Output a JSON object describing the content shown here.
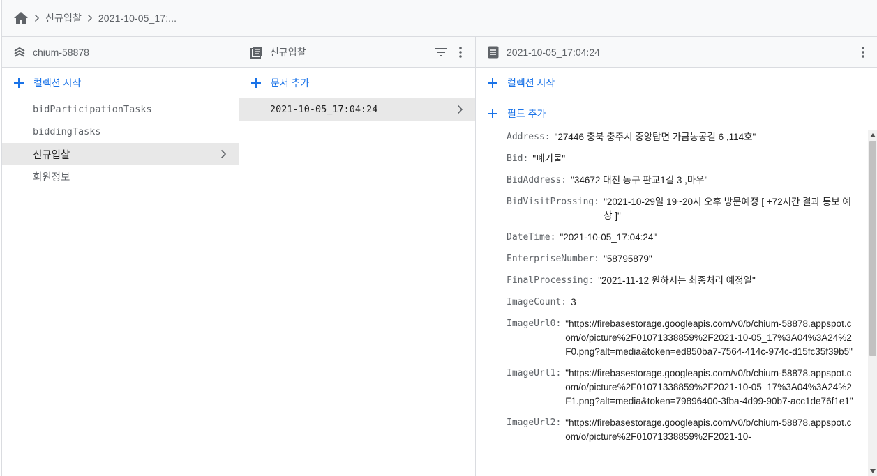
{
  "breadcrumb": {
    "items": [
      "신규입찰",
      "2021-10-05_17:..."
    ]
  },
  "project_panel": {
    "title": "chium-58878",
    "start_collection": "컬렉션 시작",
    "collections": [
      "bidParticipationTasks",
      "biddingTasks",
      "신규입찰",
      "회원정보"
    ]
  },
  "collection_panel": {
    "title": "신규입찰",
    "add_document": "문서 추가",
    "documents": [
      "2021-10-05_17:04:24"
    ]
  },
  "document_panel": {
    "title": "2021-10-05_17:04:24",
    "start_collection": "컬렉션 시작",
    "add_field": "필드 추가",
    "fields": [
      {
        "name": "Address:",
        "value": "\"27446 충북 충주시 중앙탑면 가금농공길 6 ,114호\""
      },
      {
        "name": "Bid:",
        "value": "\"폐기물\""
      },
      {
        "name": "BidAddress:",
        "value": "\"34672 대전 동구 판교1길 3 ,마우\""
      },
      {
        "name": "BidVisitProssing:",
        "value": "\"2021-10-29일 19~20시 오후 방문예정 [ +72시간 결과 통보 예상 ]\""
      },
      {
        "name": "DateTime:",
        "value": "\"2021-10-05_17:04:24\""
      },
      {
        "name": "EnterpriseNumber:",
        "value": "\"58795879\""
      },
      {
        "name": "FinalProcessing:",
        "value": "\"2021-11-12 원하시는 최종처리 예정일\""
      },
      {
        "name": "ImageCount:",
        "value": "3"
      },
      {
        "name": "ImageUrl0:",
        "value": "\"https://firebasestorage.googleapis.com/v0/b/chium-58878.appspot.com/o/picture%2F01071338859%2F2021-10-05_17%3A04%3A24%2F0.png?alt=media&token=ed850ba7-7564-414c-974c-d15fc35f39b5\""
      },
      {
        "name": "ImageUrl1:",
        "value": "\"https://firebasestorage.googleapis.com/v0/b/chium-58878.appspot.com/o/picture%2F01071338859%2F2021-10-05_17%3A04%3A24%2F1.png?alt=media&token=79896400-3fba-4d99-90b7-acc1de76f1e1\""
      },
      {
        "name": "ImageUrl2:",
        "value": "\"https://firebasestorage.googleapis.com/v0/b/chium-58878.appspot.com/o/picture%2F01071338859%2F2021-10-"
      }
    ]
  },
  "colors": {
    "accent": "#1a73e8",
    "header_bg": "#f8f9fa",
    "selected_bg": "#e8e8e8",
    "border": "#dadce0",
    "muted_text": "#5f6368"
  },
  "icons": [
    "home-icon",
    "chevron-right-icon",
    "firebase-layers-icon",
    "collection-icon",
    "document-icon",
    "filter-icon",
    "more-vert-icon",
    "plus-icon"
  ]
}
